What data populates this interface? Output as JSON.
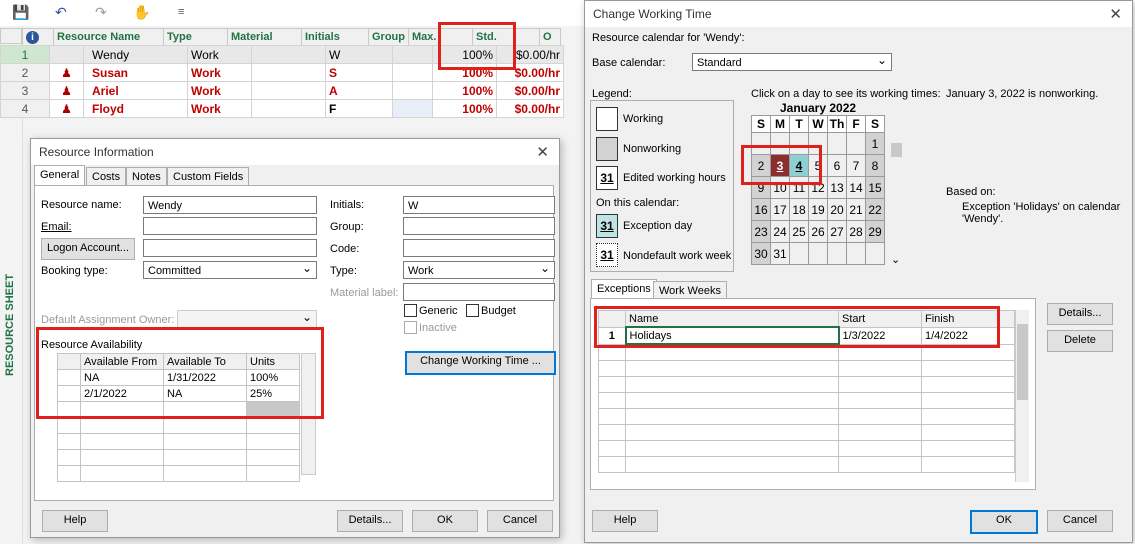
{
  "qat": {
    "undo_icon": "undo-icon",
    "redo_icon": "redo-icon"
  },
  "sheet": {
    "side_label": "RESOURCE SHEET",
    "columns": [
      "Resource Name",
      "Type",
      "Material",
      "Initials",
      "Group",
      "Max.",
      "Std.",
      "O"
    ],
    "rows": [
      {
        "num": "1",
        "name": "Wendy",
        "type": "Work",
        "initials": "W",
        "max": "100%",
        "std": "$0.00/hr"
      },
      {
        "num": "2",
        "name": "Susan",
        "type": "Work",
        "initials": "S",
        "max": "100%",
        "std": "$0.00/hr"
      },
      {
        "num": "3",
        "name": "Ariel",
        "type": "Work",
        "initials": "A",
        "max": "100%",
        "std": "$0.00/hr"
      },
      {
        "num": "4",
        "name": "Floyd",
        "type": "Work",
        "initials": "F",
        "max": "100%",
        "std": "$0.00/hr"
      }
    ]
  },
  "resource_info": {
    "title": "Resource Information",
    "tabs": [
      "General",
      "Costs",
      "Notes",
      "Custom Fields"
    ],
    "resource_name_label": "Resource name:",
    "resource_name": "Wendy",
    "email_label": "Email:",
    "logon_label": "Logon Account...",
    "booking_label": "Booking type:",
    "booking_value": "Committed",
    "initials_label": "Initials:",
    "initials_value": "W",
    "group_label": "Group:",
    "code_label": "Code:",
    "type_label": "Type:",
    "type_value": "Work",
    "material_label": "Material label:",
    "generic_label": "Generic",
    "budget_label": "Budget",
    "inactive_label": "Inactive",
    "default_owner_label": "Default Assignment Owner:",
    "availability_label": "Resource Availability",
    "avail_cols": [
      "Available From",
      "Available To",
      "Units"
    ],
    "avail_rows": [
      {
        "from": "NA",
        "to": "1/31/2022",
        "units": "100%"
      },
      {
        "from": "2/1/2022",
        "to": "NA",
        "units": "25%"
      }
    ],
    "change_working_time": "Change Working Time ...",
    "help": "Help",
    "details": "Details...",
    "ok": "OK",
    "cancel": "Cancel"
  },
  "cwt": {
    "title": "Change Working Time",
    "calendar_for": "Resource calendar for 'Wendy':",
    "base_calendar_label": "Base calendar:",
    "base_calendar_value": "Standard",
    "legend_label": "Legend:",
    "legend_working": "Working",
    "legend_nonworking": "Nonworking",
    "legend_edited": "Edited working hours",
    "on_this_calendar": "On this calendar:",
    "legend_exception": "Exception day",
    "legend_nondefault": "Nondefault work week",
    "legend_day_num": "31",
    "click_hint": "Click on a day to see its working times:",
    "status_text": "January 3, 2022 is nonworking.",
    "month": "January 2022",
    "weekdays": [
      "S",
      "M",
      "T",
      "W",
      "Th",
      "F",
      "S"
    ],
    "based_on_label": "Based on:",
    "based_on_text": "Exception 'Holidays' on calendar 'Wendy'.",
    "tabs": [
      "Exceptions",
      "Work Weeks"
    ],
    "exc_cols": [
      "Name",
      "Start",
      "Finish"
    ],
    "exc_rows": [
      {
        "num": "1",
        "name": "Holidays",
        "start": "1/3/2022",
        "finish": "1/4/2022"
      }
    ],
    "details": "Details...",
    "delete": "Delete",
    "help": "Help",
    "ok": "OK",
    "cancel": "Cancel"
  }
}
